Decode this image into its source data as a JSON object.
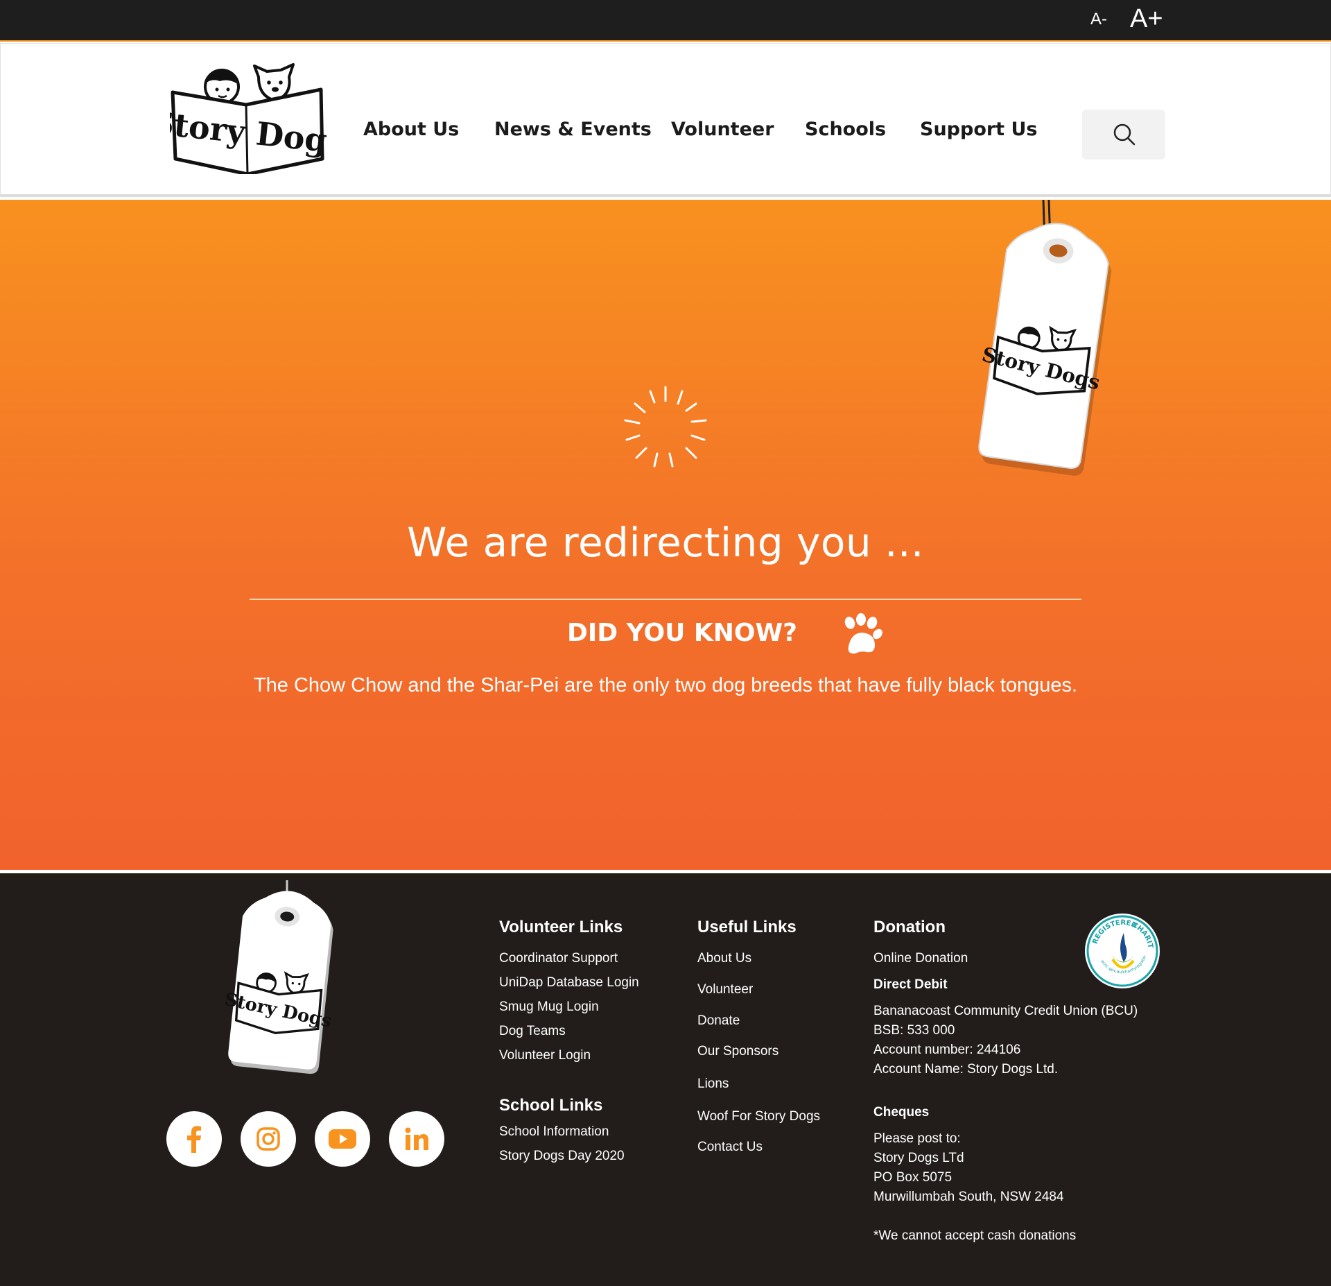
{
  "topbar": {
    "font_decrease": "A-",
    "font_increase": "A+"
  },
  "brand": {
    "name": "Story Dogs"
  },
  "nav": {
    "items": [
      {
        "label": "About Us"
      },
      {
        "label": "News & Events"
      },
      {
        "label": "Volunteer"
      },
      {
        "label": "Schools"
      },
      {
        "label": "Support Us"
      }
    ],
    "search_icon": "search-icon"
  },
  "hero": {
    "title": "We are redirecting you ...",
    "did_you_know_title": "DID YOU KNOW?",
    "did_you_know_text": "The Chow Chow and the Shar-Pei are the only two dog breeds that have fully black tongues.",
    "icons": [
      "loading-spinner-icon",
      "paw-icon"
    ]
  },
  "footer": {
    "social_icons": [
      "facebook-icon",
      "instagram-icon",
      "youtube-icon",
      "linkedin-icon"
    ],
    "volunteer_links": {
      "title": "Volunteer Links",
      "items": [
        "Coordinator Support",
        "UniDap Database Login",
        "Smug Mug Login",
        "Dog Teams",
        "Volunteer Login"
      ]
    },
    "school_links": {
      "title": "School Links",
      "items": [
        "School Information",
        "Story Dogs Day 2020"
      ]
    },
    "useful_links": {
      "title": "Useful Links",
      "items": [
        "About Us",
        "Volunteer",
        "Donate",
        "Our Sponsors",
        "Lions",
        "Woof For Story Dogs",
        "Contact Us"
      ]
    },
    "donation": {
      "title": "Donation",
      "online_link": "Online Donation",
      "direct_debit_title": "Direct Debit",
      "direct_debit_lines": [
        "Bananacoast Community Credit Union (BCU)",
        "BSB: 533 000",
        "Account number: 244106",
        "Account Name: Story Dogs Ltd."
      ],
      "cheques_title": "Cheques",
      "cheques_lines": [
        "Please post to:",
        "Story Dogs LTd",
        "PO Box 5075",
        "Murwillumbah South, NSW 2484"
      ],
      "note": "*We cannot accept cash donations"
    },
    "charity_badge": {
      "top_text": "REGISTERED",
      "right_text": "CHARITY",
      "bottom_text": "acnc.gov.au/charityregister"
    }
  },
  "colors": {
    "orange_top": "#f8911f",
    "orange_bottom": "#f1622c",
    "dark": "#221d1b",
    "accent": "#f7931e"
  }
}
